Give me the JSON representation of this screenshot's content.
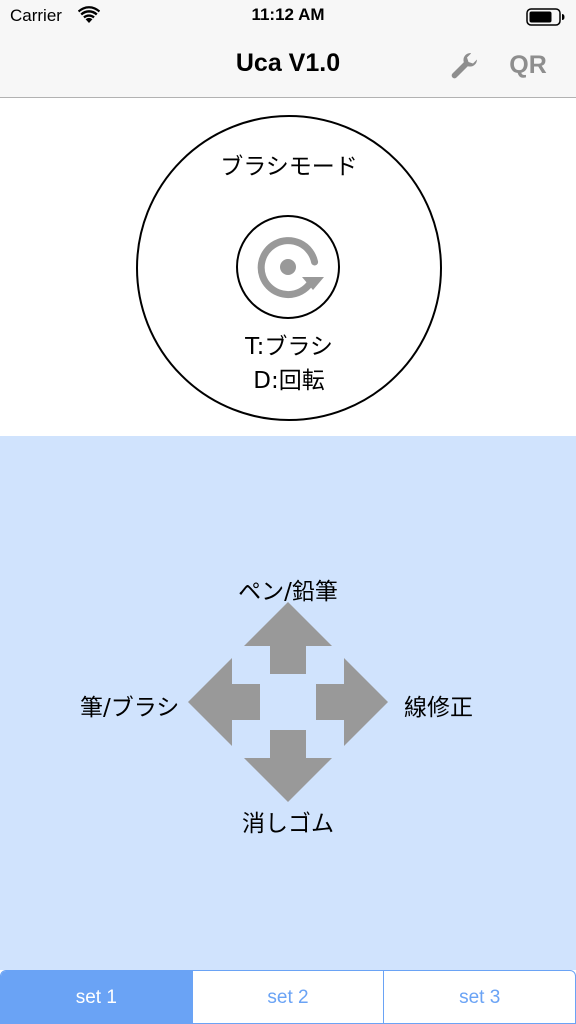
{
  "status_bar": {
    "carrier": "Carrier",
    "time": "11:12 AM"
  },
  "nav": {
    "title": "Uca V1.0",
    "settings_icon": "wrench-icon",
    "qr_label": "QR"
  },
  "mode_dial": {
    "title": "ブラシモード",
    "center_icon": "rotate-icon",
    "tap_action": "T:ブラシ",
    "drag_action": "D:回転"
  },
  "gesture_pad": {
    "background": "#d0e3fd",
    "arrow_color": "#999999",
    "up_label": "ペン/鉛筆",
    "down_label": "消しゴム",
    "left_label": "筆/ブラシ",
    "right_label": "線修正"
  },
  "tabs": {
    "accent": "#6aa3f5",
    "items": [
      {
        "label": "set 1",
        "selected": true
      },
      {
        "label": "set 2",
        "selected": false
      },
      {
        "label": "set 3",
        "selected": false
      }
    ]
  }
}
